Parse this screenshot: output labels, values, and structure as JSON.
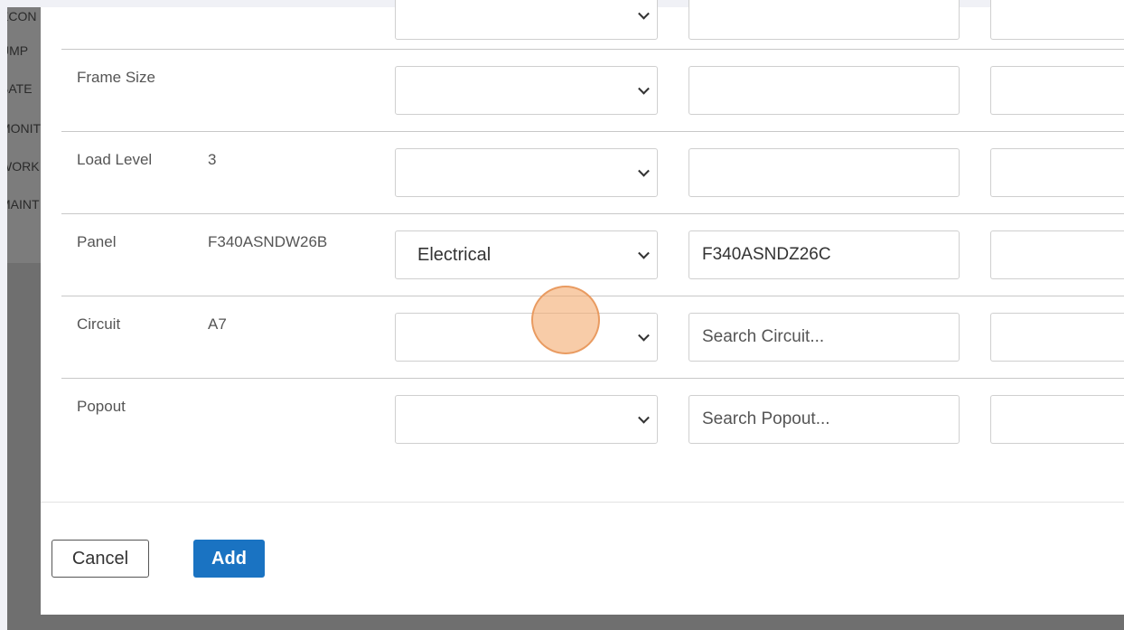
{
  "background": {
    "sidebar_items": [
      "ECON",
      "UMP",
      "BATE",
      "MONIT",
      "WORK",
      "MAINT"
    ]
  },
  "form": {
    "rows": [
      {
        "label": "",
        "value": "",
        "select": "",
        "input": "",
        "input_placeholder": ""
      },
      {
        "label": "Frame Size",
        "value": "",
        "select": "",
        "input": "",
        "input_placeholder": ""
      },
      {
        "label": "Load Level",
        "value": "3",
        "select": "",
        "input": "",
        "input_placeholder": ""
      },
      {
        "label": "Panel",
        "value": "F340ASNDW26B",
        "select": "Electrical",
        "input": "F340ASNDZ26C",
        "input_placeholder": ""
      },
      {
        "label": "Circuit",
        "value": "A7",
        "select": "",
        "input": "",
        "input_placeholder": "Search Circuit..."
      },
      {
        "label": "Popout",
        "value": "",
        "select": "",
        "input": "",
        "input_placeholder": "Search Popout..."
      }
    ]
  },
  "footer": {
    "cancel_label": "Cancel",
    "add_label": "Add"
  },
  "colors": {
    "primary": "#1a73c2",
    "click_indicator": "#f4aa6e"
  }
}
